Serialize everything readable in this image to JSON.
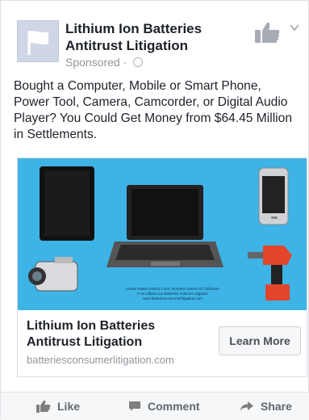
{
  "post": {
    "page_name": "Lithium Ion Batteries Antitrust Litigation",
    "sponsored_label": "Sponsored ·",
    "text": "Bought a Computer, Mobile or Smart Phone, Power Tool, Camera, Camcorder, or Digital Audio Player? You Could Get Money from $64.45 Million in Settlements."
  },
  "ad": {
    "title": "Lithium Ion Batteries Antitrust Litigation",
    "url": "batteriesconsumerlitigation.com",
    "cta_label": "Learn More",
    "image_caption": "United States District Court, Northern District Of California\nIn re Lithium Ion Batteries Antitrust Litigation\nwww.batteriesconsumerlitigation.com"
  },
  "actions": {
    "like_label": "Like",
    "comment_label": "Comment",
    "share_label": "Share"
  },
  "icons": {
    "avatar": "flag-icon",
    "top_right": "thumbs-up-icon",
    "menu": "chevron-down-icon",
    "privacy": "globe-icon"
  },
  "colors": {
    "ad_background": "#3eb3e6",
    "text": "#1d2129",
    "meta": "#90949c"
  }
}
